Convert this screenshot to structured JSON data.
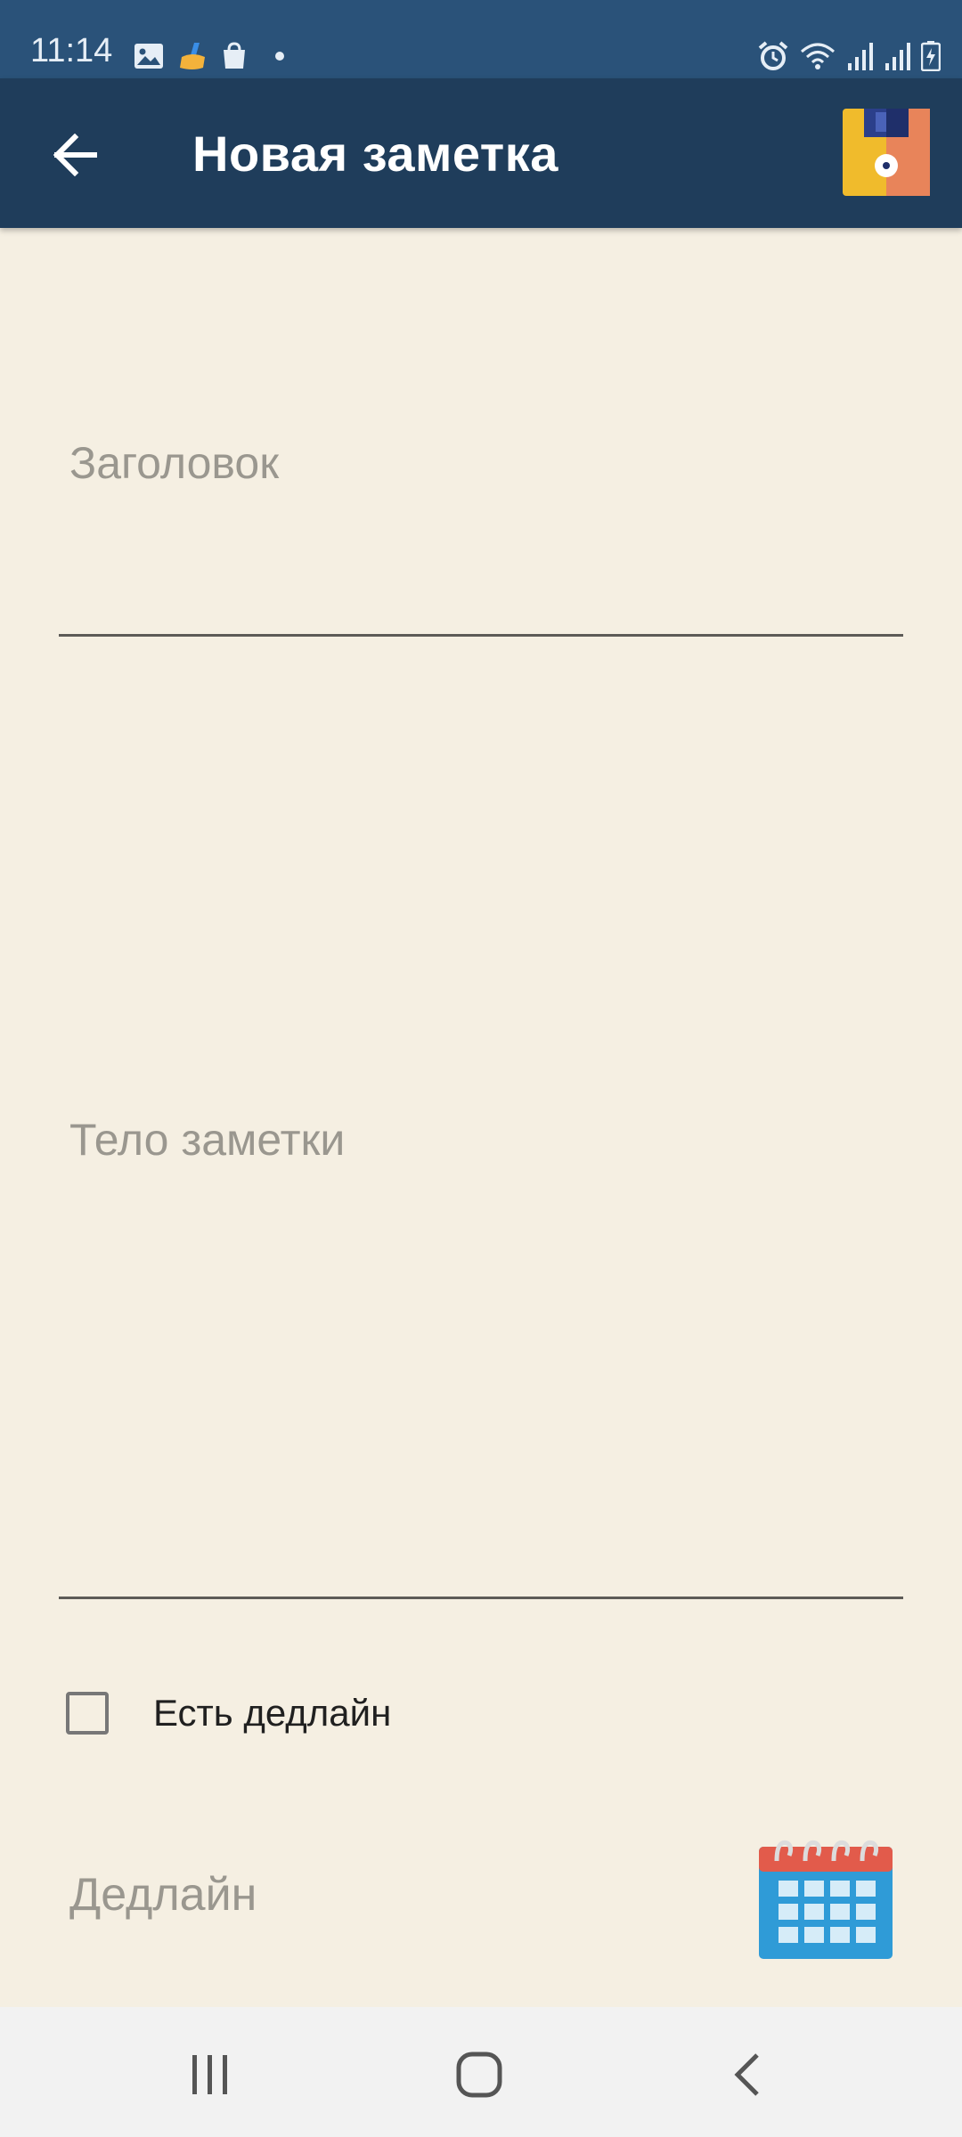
{
  "status_bar": {
    "time": "11:14",
    "left_icons": [
      "image-icon",
      "cleaner-icon",
      "shopping-bag-icon",
      "dot-icon"
    ],
    "right_icons": [
      "alarm-icon",
      "wifi-icon",
      "signal-icon",
      "signal-icon",
      "battery-charging-icon"
    ]
  },
  "app_bar": {
    "title": "Новая заметка",
    "back_icon": "arrow-left-icon",
    "save_icon": "floppy-disk-icon"
  },
  "form": {
    "title_placeholder": "Заголовок",
    "title_value": "",
    "body_placeholder": "Тело заметки",
    "body_value": "",
    "deadline_checkbox_label": "Есть дедлайн",
    "deadline_checked": false,
    "deadline_placeholder": "Дедлайн",
    "calendar_icon": "calendar-icon"
  },
  "nav_bar": {
    "items": [
      "recents-icon",
      "home-icon",
      "back-icon"
    ]
  },
  "colors": {
    "status_bar_bg": "#2a5279",
    "app_bar_bg": "#1f3d5b",
    "page_bg": "#f5efe2",
    "placeholder": "#9a978f",
    "nav_bar_bg": "#f2f2f2"
  }
}
